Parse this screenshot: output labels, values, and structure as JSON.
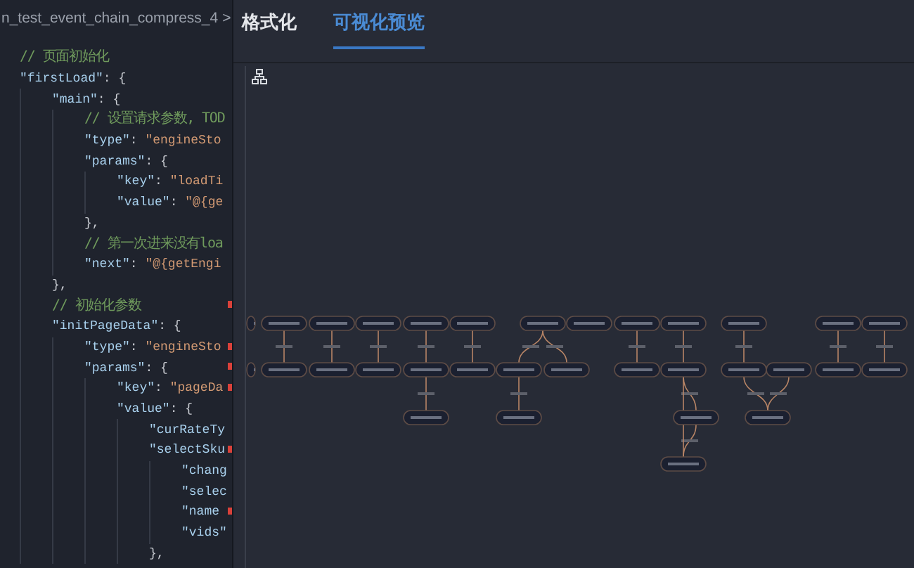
{
  "editor": {
    "breadcrumb": "n_test_event_chain_compress_4",
    "breadcrumb_separator": ">",
    "lines": [
      {
        "marked": false,
        "parts": [
          {
            "kind": "comment",
            "text": "// 页面初始化"
          }
        ]
      },
      {
        "marked": false,
        "parts": [
          {
            "kind": "key",
            "text": "\"firstLoad\""
          },
          {
            "kind": "punct",
            "text": ": {"
          }
        ],
        "children": [
          {
            "marked": false,
            "parts": [
              {
                "kind": "key",
                "text": "\"main\""
              },
              {
                "kind": "punct",
                "text": ": {"
              }
            ],
            "children": [
              {
                "marked": false,
                "parts": [
                  {
                    "kind": "comment",
                    "text": "// 设置请求参数, TOD"
                  }
                ]
              },
              {
                "marked": false,
                "parts": [
                  {
                    "kind": "key",
                    "text": "\"type\""
                  },
                  {
                    "kind": "punct",
                    "text": ": "
                  },
                  {
                    "kind": "string",
                    "text": "\"engineSto"
                  }
                ]
              },
              {
                "marked": false,
                "parts": [
                  {
                    "kind": "key",
                    "text": "\"params\""
                  },
                  {
                    "kind": "punct",
                    "text": ": {"
                  }
                ],
                "children": [
                  {
                    "marked": false,
                    "parts": [
                      {
                        "kind": "key",
                        "text": "\"key\""
                      },
                      {
                        "kind": "punct",
                        "text": ": "
                      },
                      {
                        "kind": "string",
                        "text": "\"loadTi"
                      }
                    ]
                  },
                  {
                    "marked": false,
                    "parts": [
                      {
                        "kind": "key",
                        "text": "\"value\""
                      },
                      {
                        "kind": "punct",
                        "text": ": "
                      },
                      {
                        "kind": "string",
                        "text": "\"@{ge"
                      }
                    ]
                  }
                ]
              },
              {
                "marked": false,
                "parts": [
                  {
                    "kind": "punct",
                    "text": "},"
                  }
                ]
              },
              {
                "marked": false,
                "parts": [
                  {
                    "kind": "comment",
                    "text": "// 第一次进来没有loa"
                  }
                ]
              },
              {
                "marked": false,
                "parts": [
                  {
                    "kind": "key",
                    "text": "\"next\""
                  },
                  {
                    "kind": "punct",
                    "text": ": "
                  },
                  {
                    "kind": "string",
                    "text": "\"@{getEngi"
                  }
                ]
              }
            ]
          },
          {
            "marked": false,
            "parts": [
              {
                "kind": "punct",
                "text": "},"
              }
            ]
          },
          {
            "marked": true,
            "parts": [
              {
                "kind": "comment",
                "text": "// 初始化参数"
              }
            ]
          },
          {
            "marked": false,
            "parts": [
              {
                "kind": "key",
                "text": "\"initPageData\""
              },
              {
                "kind": "punct",
                "text": ": {"
              }
            ],
            "children": [
              {
                "marked": true,
                "parts": [
                  {
                    "kind": "key",
                    "text": "\"type\""
                  },
                  {
                    "kind": "punct",
                    "text": ": "
                  },
                  {
                    "kind": "string",
                    "text": "\"engineSto"
                  }
                ]
              },
              {
                "marked": true,
                "parts": [
                  {
                    "kind": "key",
                    "text": "\"params\""
                  },
                  {
                    "kind": "punct",
                    "text": ": {"
                  }
                ],
                "children": [
                  {
                    "marked": true,
                    "parts": [
                      {
                        "kind": "key",
                        "text": "\"key\""
                      },
                      {
                        "kind": "punct",
                        "text": ": "
                      },
                      {
                        "kind": "string",
                        "text": "\"pageDa"
                      }
                    ]
                  },
                  {
                    "marked": false,
                    "parts": [
                      {
                        "kind": "key",
                        "text": "\"value\""
                      },
                      {
                        "kind": "punct",
                        "text": ": {"
                      }
                    ],
                    "children": [
                      {
                        "marked": false,
                        "parts": [
                          {
                            "kind": "key",
                            "text": "\"curRateTy"
                          }
                        ]
                      },
                      {
                        "marked": true,
                        "parts": [
                          {
                            "kind": "key",
                            "text": "\"selectSku"
                          }
                        ],
                        "children": [
                          {
                            "marked": false,
                            "parts": [
                              {
                                "kind": "key",
                                "text": "\"chang"
                              }
                            ]
                          },
                          {
                            "marked": false,
                            "parts": [
                              {
                                "kind": "key",
                                "text": "\"selec"
                              }
                            ]
                          },
                          {
                            "marked": true,
                            "parts": [
                              {
                                "kind": "key",
                                "text": "\"name"
                              }
                            ]
                          },
                          {
                            "marked": false,
                            "parts": [
                              {
                                "kind": "key",
                                "text": "\"vids\""
                              }
                            ]
                          }
                        ]
                      },
                      {
                        "marked": false,
                        "parts": [
                          {
                            "kind": "punct",
                            "text": "},"
                          }
                        ]
                      }
                    ]
                  }
                ]
              }
            ]
          }
        ]
      }
    ]
  },
  "tabs": [
    {
      "label": "格式化",
      "selected": false
    },
    {
      "label": "可视化预览",
      "selected": true
    }
  ]
}
